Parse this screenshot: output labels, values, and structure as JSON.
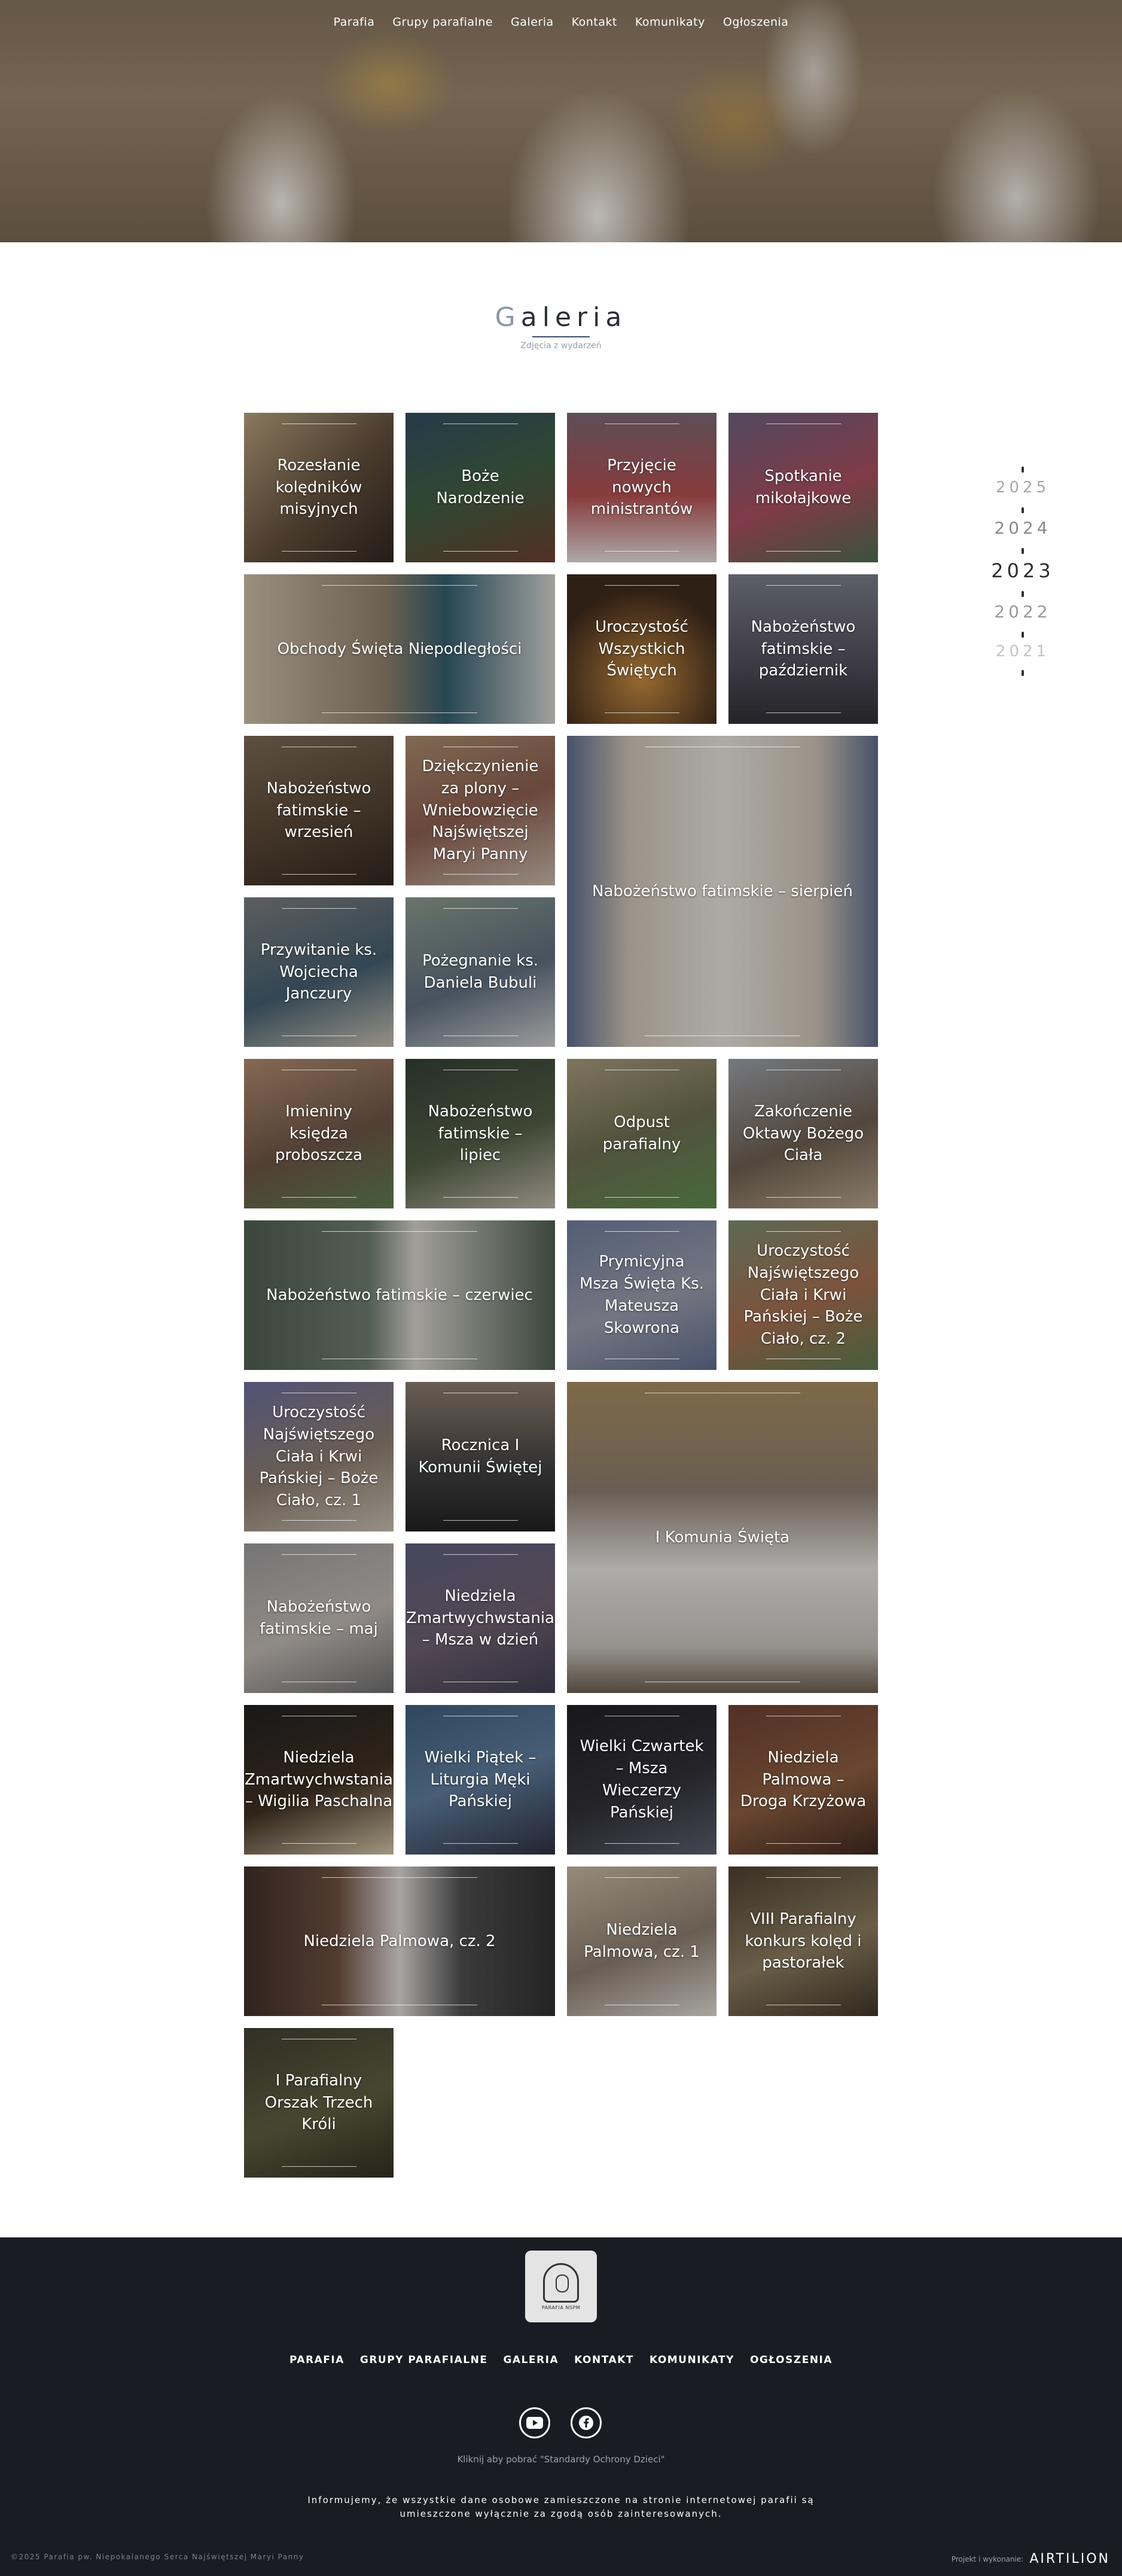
{
  "nav": {
    "items": [
      "Parafia",
      "Grupy parafialne",
      "Galeria",
      "Kontakt",
      "Komunikaty",
      "Ogłoszenia"
    ]
  },
  "header": {
    "title_first_letter": "G",
    "title_rest": "aleria",
    "subtitle": "Zdjęcia z wydarzeń"
  },
  "years": {
    "items": [
      "2025",
      "2024",
      "2023",
      "2022",
      "2021"
    ],
    "active": "2023"
  },
  "gallery": {
    "items": [
      {
        "label": "Rozesłanie kolędników misyjnych"
      },
      {
        "label": "Boże Narodzenie"
      },
      {
        "label": "Przyjęcie nowych ministrantów"
      },
      {
        "label": "Spotkanie mikołajkowe"
      },
      {
        "label": "Obchody Święta Niepodległości"
      },
      {
        "label": "Uroczystość Wszystkich Świętych"
      },
      {
        "label": "Nabożeństwo fatimskie – październik"
      },
      {
        "label": "Nabożeństwo fatimskie – wrzesień"
      },
      {
        "label": "Dziękczynienie za plony – Wniebowzięcie Najświętszej Maryi Panny"
      },
      {
        "label": "Nabożeństwo fatimskie – sierpień"
      },
      {
        "label": "Przywitanie ks. Wojciecha Janczury"
      },
      {
        "label": "Pożegnanie ks. Daniela Bubuli"
      },
      {
        "label": "Imieniny księdza proboszcza"
      },
      {
        "label": "Nabożeństwo fatimskie – lipiec"
      },
      {
        "label": "Odpust parafialny"
      },
      {
        "label": "Zakończenie Oktawy Bożego Ciała"
      },
      {
        "label": "Nabożeństwo fatimskie – czerwiec"
      },
      {
        "label": "Prymicyjna Msza Święta Ks. Mateusza Skowrona"
      },
      {
        "label": "Uroczystość Najświętszego Ciała i Krwi Pańskiej – Boże Ciało, cz. 2"
      },
      {
        "label": "Uroczystość Najświętszego Ciała i Krwi Pańskiej – Boże Ciało, cz. 1"
      },
      {
        "label": "Rocznica I Komunii Świętej"
      },
      {
        "label": "I Komunia Święta"
      },
      {
        "label": "Nabożeństwo fatimskie – maj"
      },
      {
        "label": "Niedziela Zmartwychwstania – Msza w dzień"
      },
      {
        "label": "Niedziela Zmartwychwstania – Wigilia Paschalna"
      },
      {
        "label": "Wielki Piątek – Liturgia Męki Pańskiej"
      },
      {
        "label": "Wielki Czwartek – Msza Wieczerzy Pańskiej"
      },
      {
        "label": "Niedziela Palmowa – Droga Krzyżowa"
      },
      {
        "label": "Niedziela Palmowa, cz. 2"
      },
      {
        "label": "Niedziela Palmowa, cz. 1"
      },
      {
        "label": "VIII Parafialny konkurs kolęd i pastorałek"
      },
      {
        "label": "I Parafialny Orszak Trzech Króli"
      }
    ]
  },
  "footer": {
    "logo_caption": "PARAFIA NSPM",
    "nav": [
      "PARAFIA",
      "GRUPY PARAFIALNE",
      "GALERIA",
      "KONTAKT",
      "KOMUNIKATY",
      "OGŁOSZENIA"
    ],
    "download_text": "Kliknij aby pobrać \"Standardy Ochrony Dzieci\"",
    "notice": "Informujemy, że wszystkie dane osobowe zamieszczone na stronie internetowej parafii są umieszczone wyłącznie za zgodą osób zainteresowanych.",
    "copyright": "©2025 Parafia pw. Niepokalanego Serca Najświętszej Maryi Panny",
    "credit_small": "Projekt i wykonanie:",
    "credit_brand": "AIRTILION"
  }
}
